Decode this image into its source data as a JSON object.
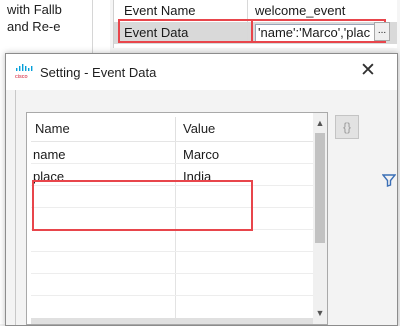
{
  "background": {
    "left_panel_lines": [
      "with Fallb",
      "and Re-e"
    ],
    "properties": [
      {
        "key": "Event Name",
        "value": "welcome_event"
      },
      {
        "key": "Event Data",
        "value": "'name':'Marco','plac"
      }
    ],
    "ellipsis_label": "..."
  },
  "dialog": {
    "title": "Setting - Event Data",
    "close_glyph": "✕",
    "columns": {
      "name": "Name",
      "value": "Value"
    },
    "rows": [
      {
        "name": "name",
        "value": "Marco"
      },
      {
        "name": "place",
        "value": "India"
      }
    ],
    "side_button_glyph": "{}"
  },
  "colors": {
    "highlight_red": "#e8454b",
    "cisco_blue": "#049fd9"
  },
  "icons": [
    "cisco-logo-icon",
    "close-icon",
    "mouse-cursor-icon",
    "braces-icon",
    "filter-icon",
    "scroll-up-icon",
    "scroll-down-icon"
  ]
}
